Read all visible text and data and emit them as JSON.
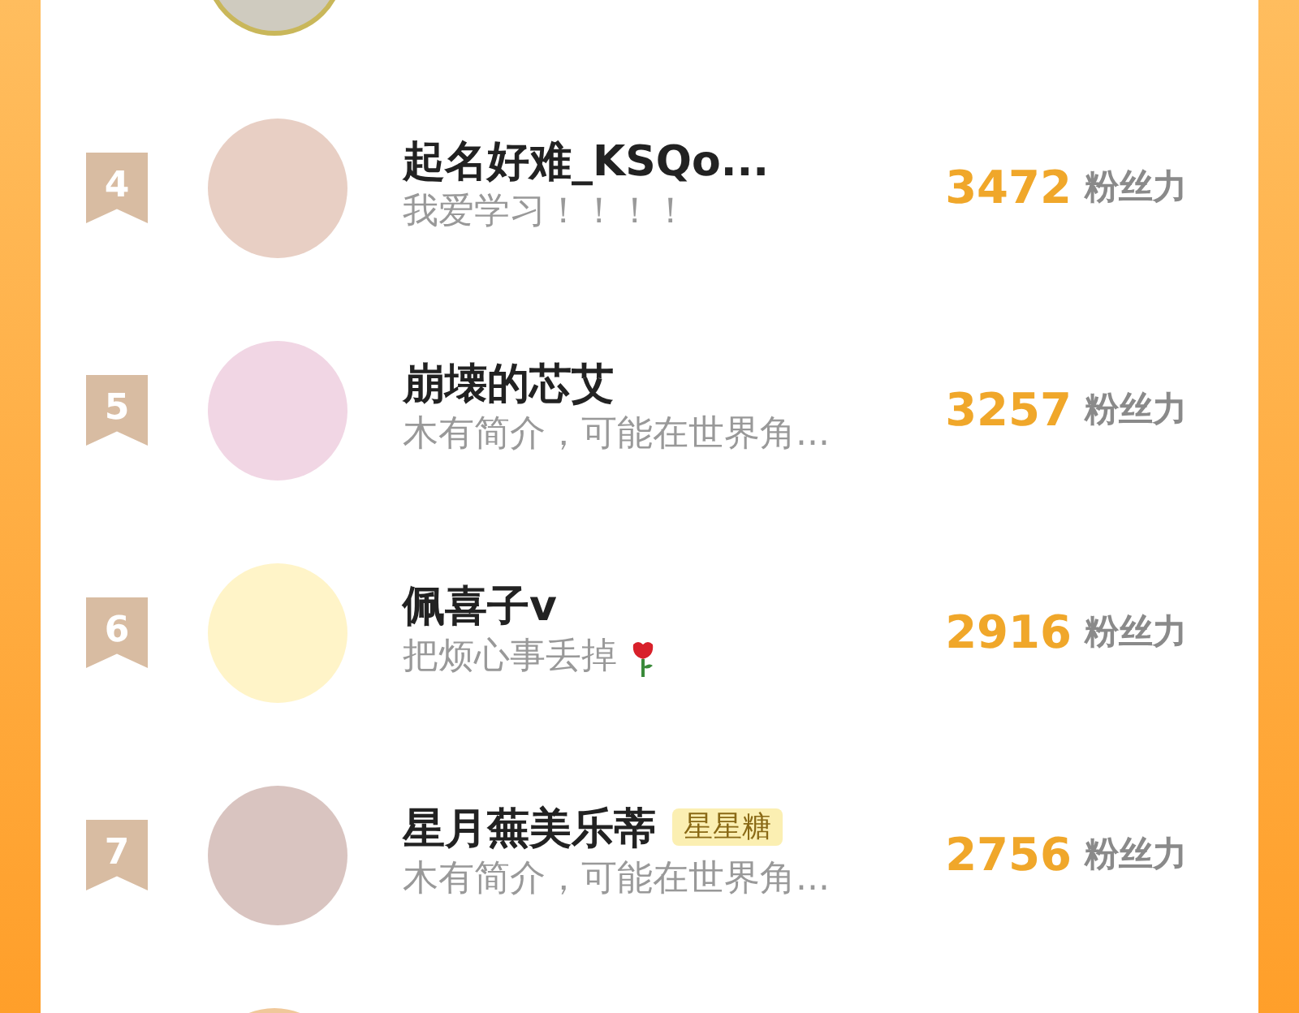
{
  "rows": [
    {
      "rank": "4",
      "name": "起名好难_KSQo...",
      "bio": "我爱学习！！！！",
      "score": "3472",
      "score_label": "粉丝力",
      "bio_icon": false
    },
    {
      "rank": "5",
      "name": "崩壊的芯艾",
      "bio": "木有简介，可能在世界角...",
      "score": "3257",
      "score_label": "粉丝力",
      "bio_icon": false
    },
    {
      "rank": "6",
      "name": "佩喜子v",
      "bio": "把烦心事丢掉",
      "score": "2916",
      "score_label": "粉丝力",
      "bio_icon": true
    },
    {
      "rank": "7",
      "name": "星月蕪美乐蒂",
      "tag": "星星糖",
      "bio": "木有简介，可能在世界角...",
      "score": "2756",
      "score_label": "粉丝力",
      "bio_icon": false
    }
  ]
}
